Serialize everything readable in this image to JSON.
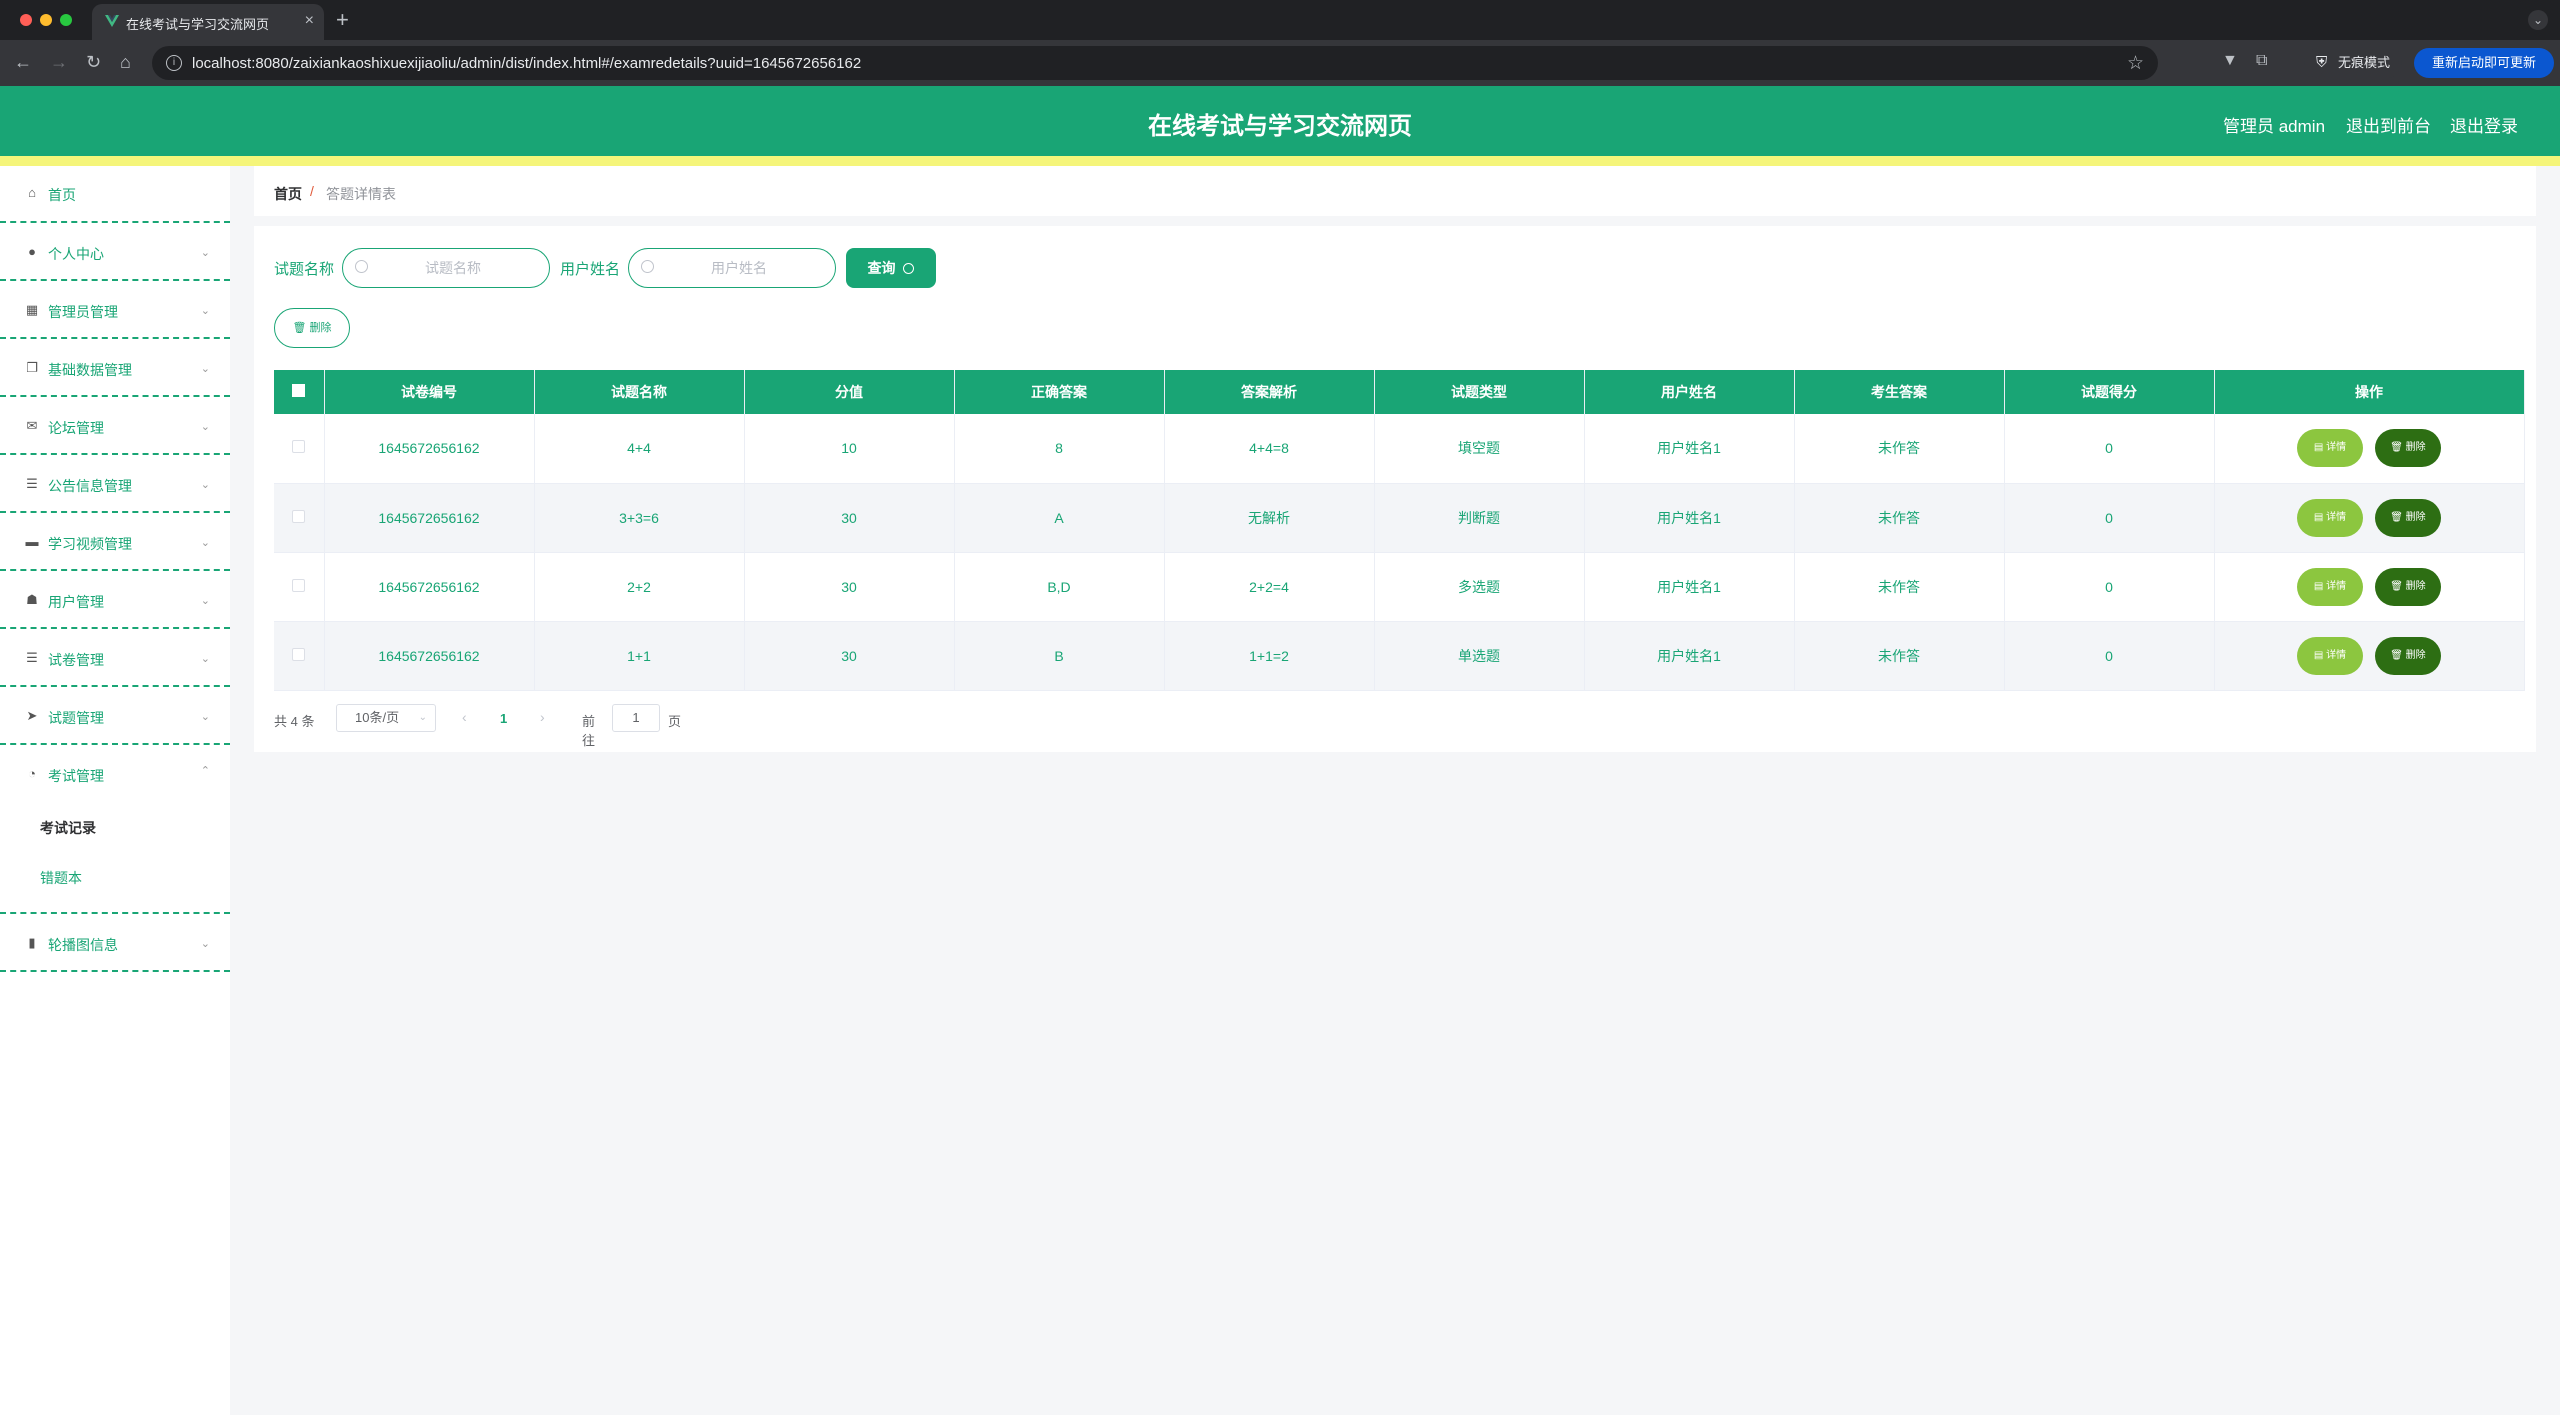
{
  "browser": {
    "tab_title": "在线考试与学习交流网页",
    "url": "localhost:8080/zaixiankaoshixuexijiaoliu/admin/dist/index.html#/examredetails?uuid=1645672656162",
    "incognito_label": "无痕模式",
    "update_label": "重新启动即可更新"
  },
  "header": {
    "title": "在线考试与学习交流网页",
    "user": "管理员 admin",
    "front_link": "退出到前台",
    "logout": "退出登录"
  },
  "sidebar": {
    "items": [
      {
        "label": "首页",
        "icon": "home-icon"
      },
      {
        "label": "个人中心",
        "icon": "user-icon"
      },
      {
        "label": "管理员管理",
        "icon": "grid-icon"
      },
      {
        "label": "基础数据管理",
        "icon": "copy-icon"
      },
      {
        "label": "论坛管理",
        "icon": "mail-icon"
      },
      {
        "label": "公告信息管理",
        "icon": "list-icon"
      },
      {
        "label": "学习视频管理",
        "icon": "monitor-icon"
      },
      {
        "label": "用户管理",
        "icon": "thumb-icon"
      },
      {
        "label": "试卷管理",
        "icon": "list-icon"
      },
      {
        "label": "试题管理",
        "icon": "send-icon"
      },
      {
        "label": "考试管理",
        "icon": "gauge-icon"
      },
      {
        "label": "轮播图信息",
        "icon": "chart-icon"
      }
    ],
    "sub_items": [
      "考试记录",
      "错题本"
    ]
  },
  "breadcrumb": {
    "home": "首页",
    "separator": "/",
    "current": "答题详情表"
  },
  "filters": {
    "name_label": "试题名称",
    "name_placeholder": "试题名称",
    "user_label": "用户姓名",
    "user_placeholder": "用户姓名",
    "query_button": "查询",
    "delete_button": "删除"
  },
  "table": {
    "columns": [
      "试卷编号",
      "试题名称",
      "分值",
      "正确答案",
      "答案解析",
      "试题类型",
      "用户姓名",
      "考生答案",
      "试题得分",
      "操作"
    ],
    "rows": [
      [
        "1645672656162",
        "4+4",
        "10",
        "8",
        "4+4=8",
        "填空题",
        "用户姓名1",
        "未作答",
        "0"
      ],
      [
        "1645672656162",
        "3+3=6",
        "30",
        "A",
        "无解析",
        "判断题",
        "用户姓名1",
        "未作答",
        "0"
      ],
      [
        "1645672656162",
        "2+2",
        "30",
        "B,D",
        "2+2=4",
        "多选题",
        "用户姓名1",
        "未作答",
        "0"
      ],
      [
        "1645672656162",
        "1+1",
        "30",
        "B",
        "1+1=2",
        "单选题",
        "用户姓名1",
        "未作答",
        "0"
      ]
    ],
    "detail_label": "详情",
    "delete_label": "删除"
  },
  "pagination": {
    "total": "共 4 条",
    "page_size": "10条/页",
    "current_page": "1",
    "goto_label": "前往",
    "goto_value": "1",
    "page_unit": "页"
  },
  "colors": {
    "primary": "#19a575",
    "accent_strip": "#f5f57a",
    "detail_button": "#8cc63f",
    "delete_button": "#2d6e13"
  }
}
